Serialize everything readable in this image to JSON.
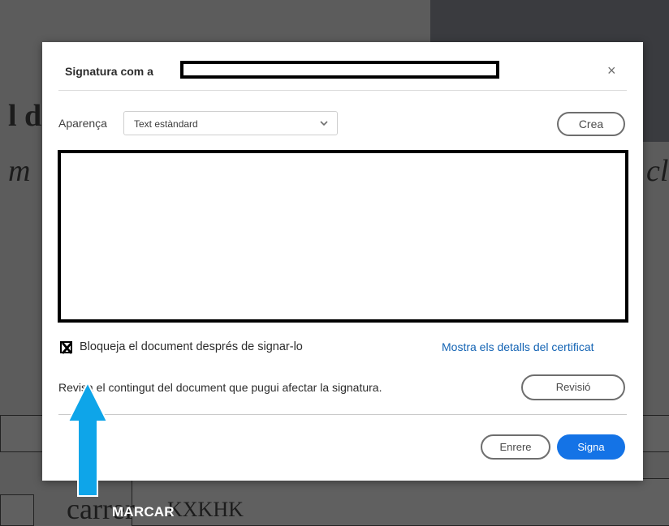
{
  "background_document": {
    "text_fragment_1": "l d'",
    "text_fragment_2": "m",
    "text_fragment_3": "cl",
    "text_fragment_4": "carrer",
    "text_fragment_5": "KXKHK"
  },
  "dialog": {
    "title": "Signatura com a",
    "close_glyph": "×",
    "appearance": {
      "label": "Aparença",
      "selected": "Text estàndard"
    },
    "create_button": "Crea",
    "lock_checkbox": {
      "checked": true,
      "label": "Bloqueja el document després de signar-lo"
    },
    "certificate_link": "Mostra els detalls del certificat",
    "review_text": "Revisa el contingut del document que pugui afectar la signatura.",
    "review_button": "Revisió",
    "back_button": "Enrere",
    "sign_button": "Signa"
  },
  "annotation": {
    "label": "MARCAR",
    "arrow_color": "#0ea5e9"
  },
  "colors": {
    "primary_button": "#1473e6",
    "link": "#1464b4",
    "annotation_arrow": "#0ea5e9"
  }
}
